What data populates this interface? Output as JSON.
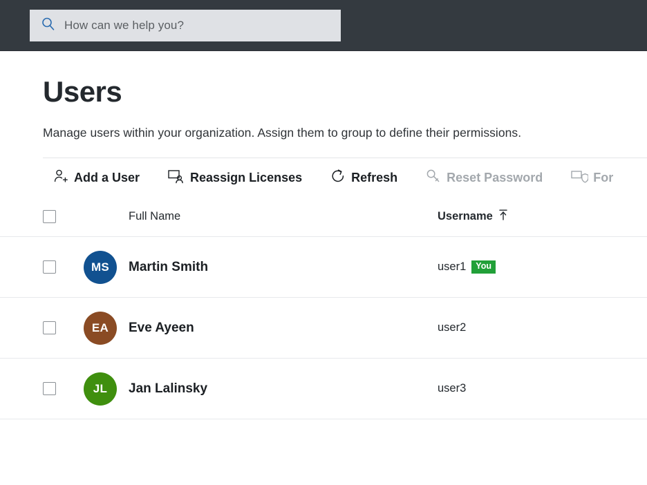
{
  "header": {
    "search": {
      "placeholder": "How can we help you?",
      "value": "",
      "icon": "search-icon"
    },
    "background_color": "#343a40",
    "search_background_color": "#dfe1e5"
  },
  "page": {
    "title": "Users",
    "description": "Manage users within your organization. Assign them to group to define their permissions."
  },
  "toolbar": {
    "items": [
      {
        "label": "Add a User",
        "icon": "person-add-icon",
        "disabled": false
      },
      {
        "label": "Reassign Licenses",
        "icon": "monitor-person-icon",
        "disabled": false
      },
      {
        "label": "Refresh",
        "icon": "refresh-icon",
        "disabled": false
      },
      {
        "label": "Reset Password",
        "icon": "key-icon",
        "disabled": true
      },
      {
        "label": "For",
        "icon": "monitor-shield-icon",
        "disabled": true
      }
    ]
  },
  "table": {
    "columns": {
      "full_name": {
        "label": "Full Name",
        "sorted": false
      },
      "username": {
        "label": "Username",
        "sorted": true,
        "sort_direction": "ascending",
        "sort_icon": "sort-ascending-icon"
      }
    },
    "select_all_checked": false,
    "rows": [
      {
        "checked": false,
        "initials": "MS",
        "avatar_color": "#115190",
        "full_name": "Martin Smith",
        "username": "user1",
        "badge": "You",
        "badge_color": "#21a038"
      },
      {
        "checked": false,
        "initials": "EA",
        "avatar_color": "#8a4b24",
        "full_name": "Eve Ayeen",
        "username": "user2",
        "badge": "",
        "badge_color": ""
      },
      {
        "checked": false,
        "initials": "JL",
        "avatar_color": "#3f8f0e",
        "full_name": "Jan Lalinsky",
        "username": "user3",
        "badge": "",
        "badge_color": ""
      }
    ]
  }
}
